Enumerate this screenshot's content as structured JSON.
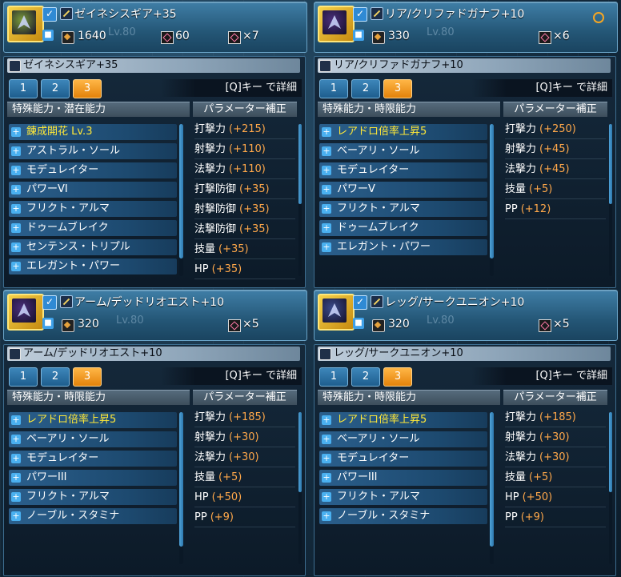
{
  "tabs": [
    "1",
    "2",
    "3"
  ],
  "detail_hint": "[Q]キー で詳細",
  "param_header": "パラメーター補正",
  "ghost_level": "Lv.80",
  "items": [
    {
      "header_name": "ゼイネシスギア+35",
      "requirement": "1640",
      "stat_value": "60",
      "slots": "×7",
      "title": "ゼイネシスギア+35",
      "ability_header": "特殊能力・潜在能力",
      "thumb_color": "#7a9a3a",
      "abilities": [
        {
          "name": "錬成開花 Lv.3",
          "highlight": true
        },
        {
          "name": "アストラル・ソール",
          "highlight": false
        },
        {
          "name": "モデュレイター",
          "highlight": false
        },
        {
          "name": "パワーVI",
          "highlight": false
        },
        {
          "name": "フリクト・アルマ",
          "highlight": false
        },
        {
          "name": "ドゥームブレイク",
          "highlight": false
        },
        {
          "name": "センテンス・トリプル",
          "highlight": false
        },
        {
          "name": "エレガント・パワー",
          "highlight": false
        }
      ],
      "params": [
        {
          "label": "打撃力",
          "value": "(+215)"
        },
        {
          "label": "射撃力",
          "value": "(+110)"
        },
        {
          "label": "法撃力",
          "value": "(+110)"
        },
        {
          "label": "打撃防御",
          "value": "(+35)"
        },
        {
          "label": "射撃防御",
          "value": "(+35)"
        },
        {
          "label": "法撃防御",
          "value": "(+35)"
        },
        {
          "label": "技量",
          "value": "(+35)"
        },
        {
          "label": "HP",
          "value": "(+35)"
        }
      ]
    },
    {
      "header_name": "リア/クリファドガナフ+10",
      "requirement": "330",
      "stat_value": "",
      "slots": "×6",
      "title": "リア/クリファドガナフ+10",
      "ability_header": "特殊能力・時限能力",
      "thumb_color": "#4a2e7a",
      "abilities": [
        {
          "name": "レアドロ倍率上昇5",
          "highlight": true
        },
        {
          "name": "ベーアリ・ソール",
          "highlight": false
        },
        {
          "name": "モデュレイター",
          "highlight": false
        },
        {
          "name": "パワーV",
          "highlight": false
        },
        {
          "name": "フリクト・アルマ",
          "highlight": false
        },
        {
          "name": "ドゥームブレイク",
          "highlight": false
        },
        {
          "name": "エレガント・パワー",
          "highlight": false
        }
      ],
      "params": [
        {
          "label": "打撃力",
          "value": "(+250)"
        },
        {
          "label": "射撃力",
          "value": "(+45)"
        },
        {
          "label": "法撃力",
          "value": "(+45)"
        },
        {
          "label": "技量",
          "value": "(+5)"
        },
        {
          "label": "PP",
          "value": "(+12)"
        }
      ]
    },
    {
      "header_name": "アーム/デッドリオエスト+10",
      "requirement": "320",
      "stat_value": "",
      "slots": "×5",
      "title": "アーム/デッドリオエスト+10",
      "ability_header": "特殊能力・時限能力",
      "thumb_color": "#4a2e7a",
      "abilities": [
        {
          "name": "レアドロ倍率上昇5",
          "highlight": true
        },
        {
          "name": "ベーアリ・ソール",
          "highlight": false
        },
        {
          "name": "モデュレイター",
          "highlight": false
        },
        {
          "name": "パワーIII",
          "highlight": false
        },
        {
          "name": "フリクト・アルマ",
          "highlight": false
        },
        {
          "name": "ノーブル・スタミナ",
          "highlight": false
        }
      ],
      "params": [
        {
          "label": "打撃力",
          "value": "(+185)"
        },
        {
          "label": "射撃力",
          "value": "(+30)"
        },
        {
          "label": "法撃力",
          "value": "(+30)"
        },
        {
          "label": "技量",
          "value": "(+5)"
        },
        {
          "label": "HP",
          "value": "(+50)"
        },
        {
          "label": "PP",
          "value": "(+9)"
        }
      ]
    },
    {
      "header_name": "レッグ/サークユニオン+10",
      "requirement": "320",
      "stat_value": "",
      "slots": "×5",
      "title": "レッグ/サークユニオン+10",
      "ability_header": "特殊能力・時限能力",
      "thumb_color": "#3a4a8a",
      "abilities": [
        {
          "name": "レアドロ倍率上昇5",
          "highlight": true
        },
        {
          "name": "ベーアリ・ソール",
          "highlight": false
        },
        {
          "name": "モデュレイター",
          "highlight": false
        },
        {
          "name": "パワーIII",
          "highlight": false
        },
        {
          "name": "フリクト・アルマ",
          "highlight": false
        },
        {
          "name": "ノーブル・スタミナ",
          "highlight": false
        }
      ],
      "params": [
        {
          "label": "打撃力",
          "value": "(+185)"
        },
        {
          "label": "射撃力",
          "value": "(+30)"
        },
        {
          "label": "法撃力",
          "value": "(+30)"
        },
        {
          "label": "技量",
          "value": "(+5)"
        },
        {
          "label": "HP",
          "value": "(+50)"
        },
        {
          "label": "PP",
          "value": "(+9)"
        }
      ]
    }
  ]
}
